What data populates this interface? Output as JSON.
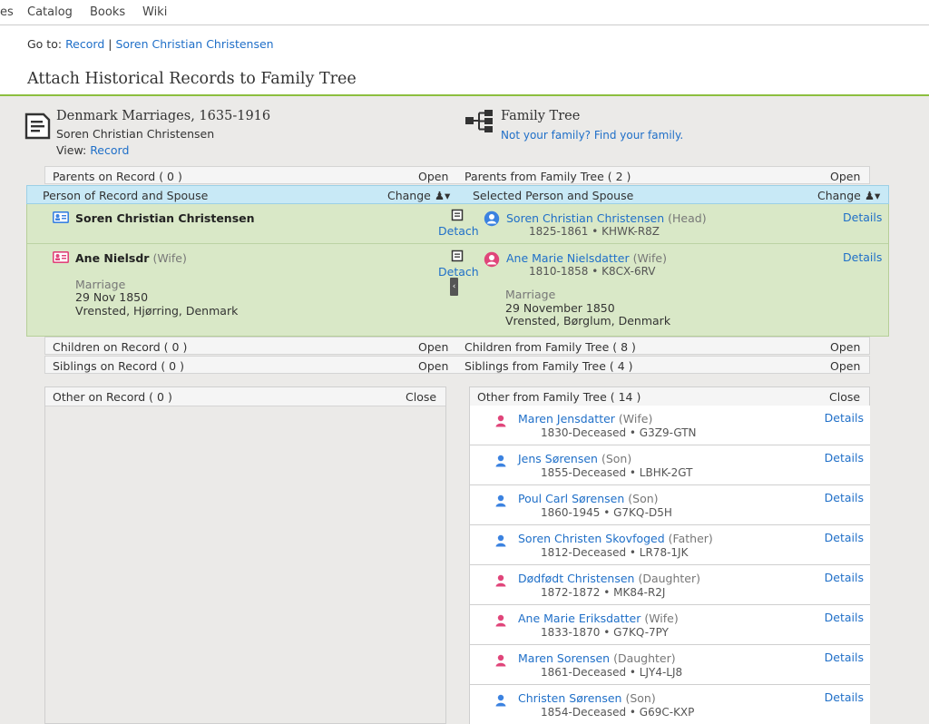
{
  "nav": {
    "items": [
      "es",
      "Catalog",
      "Books",
      "Wiki"
    ]
  },
  "goto": {
    "label": "Go to:",
    "record_link": "Record",
    "sep": "|",
    "person_link": "Soren Christian Christensen"
  },
  "page_title": "Attach Historical Records to Family Tree",
  "record": {
    "title": "Denmark Marriages, 1635-1916",
    "person": "Soren Christian Christensen",
    "view_label": "View:",
    "view_link": "Record"
  },
  "tree": {
    "title": "Family Tree",
    "link": "Not your family? Find your family."
  },
  "parents": {
    "left": "Parents on Record  ( 0 )",
    "left_action": "Open",
    "right": "Parents from Family Tree  ( 2 )",
    "right_action": "Open"
  },
  "spouse_header": {
    "left": "Person of Record and Spouse",
    "left_action": "Change",
    "right": "Selected Person and Spouse",
    "right_action": "Change"
  },
  "record_persons": [
    {
      "name": "Soren Christian Christensen",
      "role": "",
      "event_label": "",
      "event_date": "",
      "event_place": ""
    },
    {
      "name": "Ane Nielsdr",
      "role": "(Wife)",
      "event_label": "Marriage",
      "event_date": "29 Nov 1850",
      "event_place": "Vrensted, Hjørring, Denmark"
    }
  ],
  "detach_label": "Detach",
  "tree_persons": [
    {
      "name": "Soren Christian Christensen",
      "role": "(Head)",
      "dates": "1825-1861 • KHWK-R8Z",
      "details": "Details",
      "event_label": "",
      "event_date": "",
      "event_place": ""
    },
    {
      "name": "Ane Marie Nielsdatter",
      "role": "(Wife)",
      "dates": "1810-1858 • K8CX-6RV",
      "details": "Details",
      "event_label": "Marriage",
      "event_date": "29 November 1850",
      "event_place": "Vrensted, Børglum, Denmark"
    }
  ],
  "children": {
    "left": "Children on Record  ( 0 )",
    "left_action": "Open",
    "right": "Children from Family Tree  ( 8 )",
    "right_action": "Open"
  },
  "siblings": {
    "left": "Siblings on Record  ( 0 )",
    "left_action": "Open",
    "right": "Siblings from Family Tree  ( 4 )",
    "right_action": "Open"
  },
  "other_record": {
    "title": "Other on Record  ( 0 )",
    "action": "Close"
  },
  "other_tree": {
    "title": "Other from Family Tree  ( 14 )",
    "action": "Close",
    "members": [
      {
        "name": "Maren Jensdatter",
        "role": "(Wife)",
        "dates": "1830-Deceased • G3Z9-GTN",
        "gender": "female",
        "details": "Details"
      },
      {
        "name": "Jens Sørensen",
        "role": "(Son)",
        "dates": "1855-Deceased • LBHK-2GT",
        "gender": "male",
        "details": "Details"
      },
      {
        "name": "Poul Carl Sørensen",
        "role": "(Son)",
        "dates": "1860-1945 • G7KQ-D5H",
        "gender": "male",
        "details": "Details"
      },
      {
        "name": "Soren Christen Skovfoged",
        "role": "(Father)",
        "dates": "1812-Deceased • LR78-1JK",
        "gender": "male",
        "details": "Details"
      },
      {
        "name": "Dødfødt Christensen",
        "role": "(Daughter)",
        "dates": "1872-1872 • MK84-R2J",
        "gender": "female",
        "details": "Details"
      },
      {
        "name": "Ane Marie Eriksdatter",
        "role": "(Wife)",
        "dates": "1833-1870 • G7KQ-7PY",
        "gender": "female",
        "details": "Details"
      },
      {
        "name": "Maren Sorensen",
        "role": "(Daughter)",
        "dates": "1861-Deceased • LJY4-LJ8",
        "gender": "female",
        "details": "Details"
      },
      {
        "name": "Christen Sørensen",
        "role": "(Son)",
        "dates": "1854-Deceased • G69C-KXP",
        "gender": "male",
        "details": "Details"
      }
    ]
  },
  "colors": {
    "link": "#1f6fc8",
    "male": "#3b82e0",
    "female": "#e0457a",
    "green_bg": "#d9e8c7",
    "blue_header": "#c8e9f6",
    "accent_rule": "#8cbf3f"
  }
}
